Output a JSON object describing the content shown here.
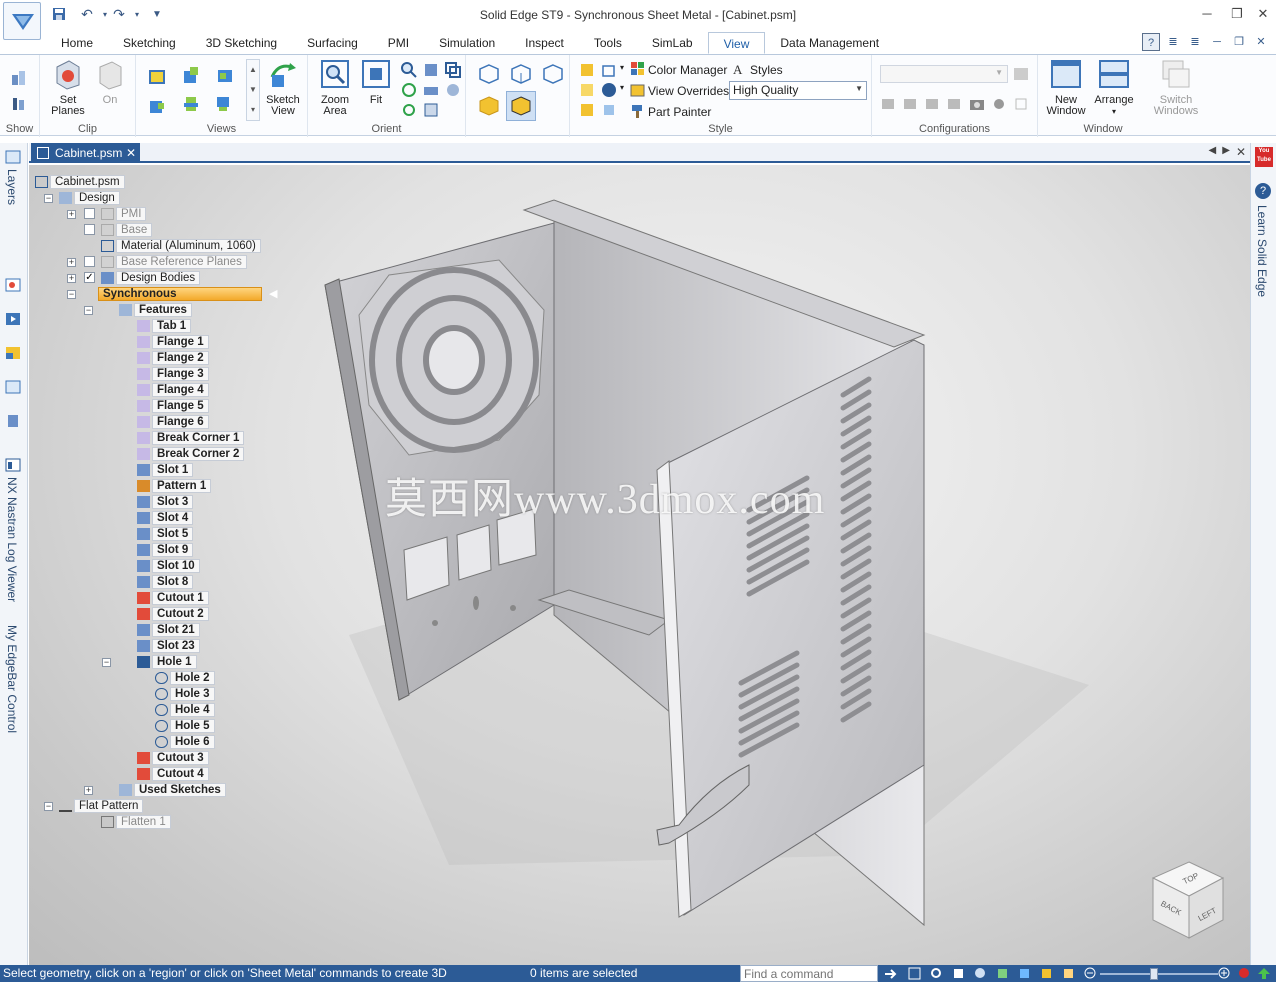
{
  "window": {
    "title": "Solid Edge ST9 - Synchronous Sheet Metal - [Cabinet.psm]",
    "minimize_icon": "minimize-icon",
    "restore_icon": "restore-icon",
    "close_icon": "close-icon"
  },
  "qat": {
    "save_icon": "save-icon",
    "undo_icon": "undo-icon",
    "redo_icon": "redo-icon",
    "customize_icon": "dropdown-icon"
  },
  "ribbon_tabs": [
    "Home",
    "Sketching",
    "3D Sketching",
    "Surfacing",
    "PMI",
    "Simulation",
    "Inspect",
    "Tools",
    "SimLab",
    "View",
    "Data Management"
  ],
  "active_tab": "View",
  "ribbon": {
    "groups": {
      "show": "Show",
      "clip": "Clip",
      "views": "Views",
      "orient": "Orient",
      "style": "Style",
      "configurations": "Configurations",
      "window": "Window"
    },
    "buttons": {
      "set_planes": "Set\nPlanes",
      "on": "On",
      "sketch_view": "Sketch\nView",
      "zoom_area": "Zoom\nArea",
      "fit": "Fit",
      "color_manager": "Color Manager",
      "styles": "Styles",
      "view_overrides": "View Overrides",
      "part_painter": "Part Painter",
      "new_window": "New\nWindow",
      "arrange": "Arrange",
      "switch_windows": "Switch\nWindows"
    },
    "quality_value": "High Quality"
  },
  "document": {
    "tab_label": "Cabinet.psm"
  },
  "left_panel": {
    "layers": "Layers",
    "nastran": "NX Nastran Log Viewer",
    "edgebar": "My EdgeBar Control"
  },
  "right_panel": {
    "youtube": "You\nTube",
    "learn": "Learn Solid Edge"
  },
  "tree": {
    "root": "Cabinet.psm",
    "design": "Design",
    "pmi": "PMI",
    "base": "Base",
    "material": "Material (Aluminum, 1060)",
    "ref_planes": "Base Reference Planes",
    "design_bodies": "Design Bodies",
    "synchronous": "Synchronous",
    "features": "Features",
    "feature_items": [
      "Tab 1",
      "Flange 1",
      "Flange 2",
      "Flange 3",
      "Flange 4",
      "Flange 5",
      "Flange 6",
      "Break Corner 1",
      "Break Corner 2",
      "Slot 1",
      "Pattern 1",
      "Slot 3",
      "Slot 4",
      "Slot 5",
      "Slot 9",
      "Slot 10",
      "Slot 8",
      "Cutout 1",
      "Cutout 2",
      "Slot 21",
      "Slot 23",
      "Hole 1"
    ],
    "hole_children": [
      "Hole 2",
      "Hole 3",
      "Hole 4",
      "Hole 5",
      "Hole 6"
    ],
    "after_holes": [
      "Cutout 3",
      "Cutout 4"
    ],
    "used_sketches": "Used Sketches",
    "flat_pattern": "Flat Pattern",
    "flatten": "Flatten 1"
  },
  "viewport": {
    "watermark": "莫西网www.3dmox.com",
    "cube_labels": [
      "TOP",
      "BACK",
      "LEFT"
    ]
  },
  "status": {
    "message": "Select geometry, click on a 'region' or click on 'Sheet Metal' commands to create 3D",
    "selection": "0 items are selected",
    "find_placeholder": "Find a command"
  }
}
